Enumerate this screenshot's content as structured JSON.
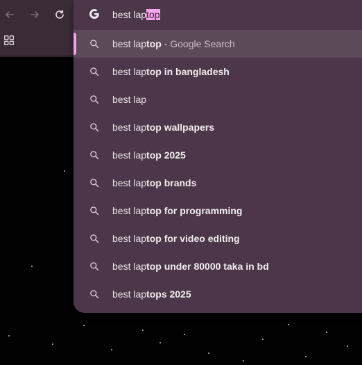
{
  "colors": {
    "toolbar_bg": "#3a2b37",
    "dropdown_bg": "#4b3747",
    "highlight_bg": "#5d4a59",
    "accent": "#f3a0e6",
    "text": "#ece3eb"
  },
  "nav": {
    "back_icon": "arrow-left-icon",
    "forward_icon": "arrow-right-icon",
    "reload_icon": "reload-icon",
    "apps_icon": "apps-grid-icon"
  },
  "omnibox": {
    "icon": "google-g-icon",
    "typed": "best lap",
    "autocomplete": "top"
  },
  "suggestions": [
    {
      "prefix": "best lap",
      "bold": "top",
      "tail": " - Google Search",
      "active": true
    },
    {
      "prefix": "best lap",
      "bold": "top in bangladesh",
      "tail": ""
    },
    {
      "prefix": "best lap",
      "bold": "",
      "tail": ""
    },
    {
      "prefix": "best lap",
      "bold": "top wallpapers",
      "tail": ""
    },
    {
      "prefix": "best lap",
      "bold": "top 2025",
      "tail": ""
    },
    {
      "prefix": "best lap",
      "bold": "top brands",
      "tail": ""
    },
    {
      "prefix": "best lap",
      "bold": "top for programming",
      "tail": ""
    },
    {
      "prefix": "best lap",
      "bold": "top for video editing",
      "tail": ""
    },
    {
      "prefix": "best lap",
      "bold": "top under 80000 taka in bd",
      "tail": ""
    },
    {
      "prefix": "best lap",
      "bold": "tops 2025",
      "tail": ""
    }
  ]
}
